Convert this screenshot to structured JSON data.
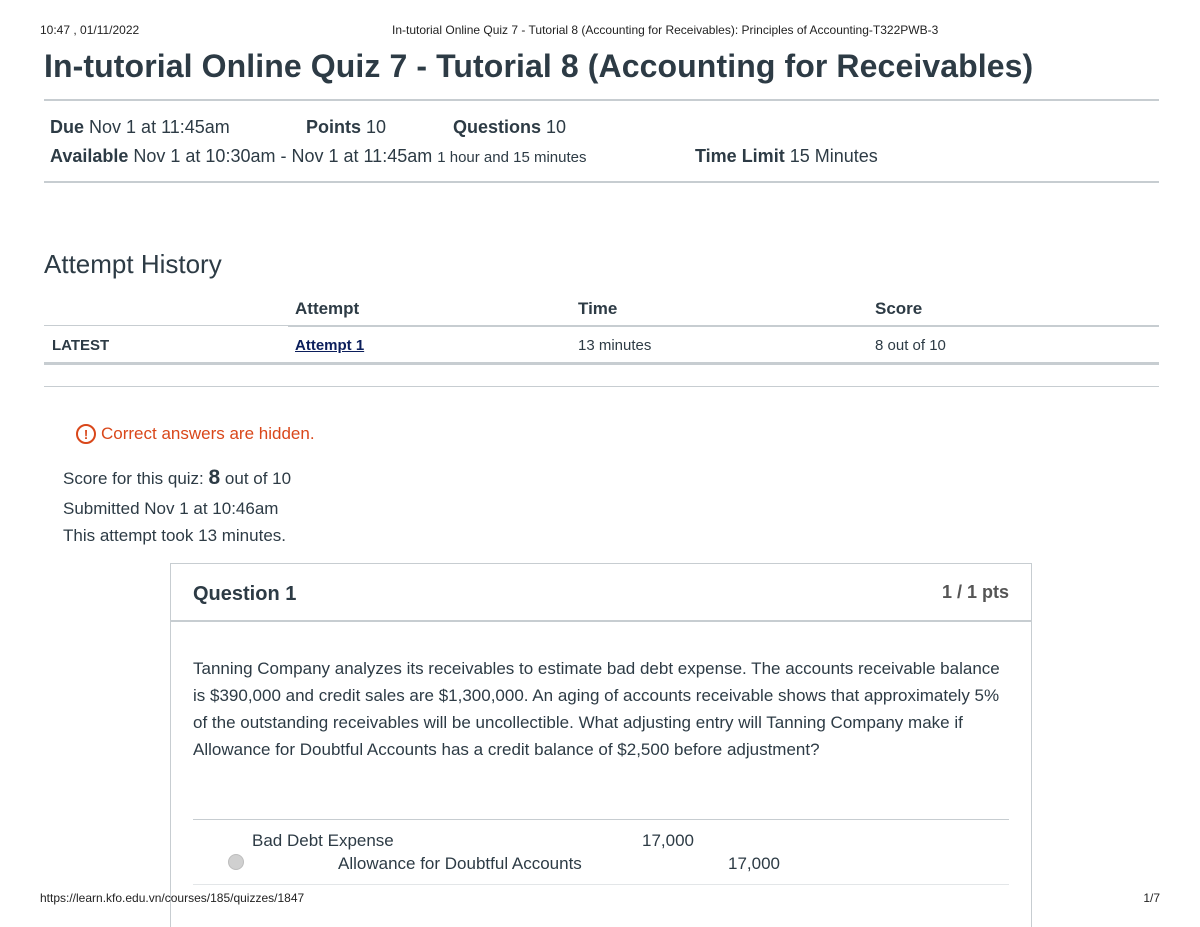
{
  "print_header": {
    "datetime": "10:47 , 01/11/2022",
    "page_title": "In-tutorial Online Quiz 7 - Tutorial 8 (Accounting for Receivables): Principles of Accounting-T322PWB-3"
  },
  "print_footer": {
    "url": "https://learn.kfo.edu.vn/courses/185/quizzes/1847",
    "page": "1/7"
  },
  "quiz": {
    "title": "In-tutorial Online Quiz 7 - Tutorial 8 (Accounting for Receivables)",
    "due_label": "Due",
    "due_value": "Nov 1 at 11:45am",
    "points_label": "Points",
    "points_value": "10",
    "questions_label": "Questions",
    "questions_value": "10",
    "available_label": "Available",
    "available_value": "Nov 1 at 10:30am - Nov 1 at 11:45am",
    "available_duration": "1 hour and 15 minutes",
    "time_limit_label": "Time Limit",
    "time_limit_value": "15 Minutes"
  },
  "attempt_history": {
    "title": "Attempt History",
    "columns": [
      "Attempt",
      "Time",
      "Score"
    ],
    "rows": [
      {
        "tag": "LATEST",
        "attempt": "Attempt 1 ",
        "time": "13 minutes",
        "score": "8 out of 10"
      }
    ]
  },
  "notice": {
    "icon": "exclamation-circle-icon",
    "text": "Correct answers are hidden.",
    "color": "#d9471a"
  },
  "result": {
    "score_prefix": "Score for this quiz: ",
    "score_value": "8",
    "score_suffix": " out of 10",
    "submitted": "Submitted Nov 1 at 10:46am",
    "duration": "This attempt took 13 minutes."
  },
  "question": {
    "title": "Question 1",
    "points": "1 / 1 pts",
    "text": "Tanning Company analyzes its receivables to estimate bad debt expense. The accounts receivable balance is $390,000 and credit sales are $1,300,000. An aging of accounts receivable shows that approximately 5% of the outstanding receivables will be uncollectible. What adjusting entry will Tanning Company make if Allowance for Doubtful Accounts has a credit balance of $2,500 before adjustment?",
    "answer_1": {
      "debit_account": "Bad Debt Expense",
      "debit_amount": "17,000",
      "credit_account": "Allowance for Doubtful Accounts",
      "credit_amount": "17,000"
    }
  }
}
